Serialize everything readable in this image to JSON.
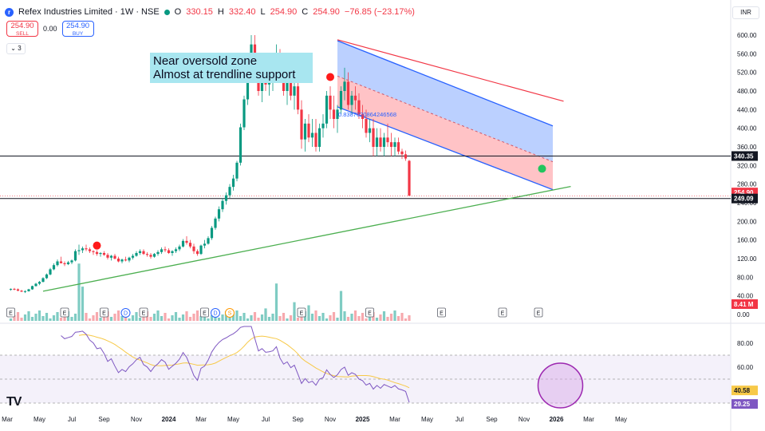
{
  "header": {
    "logo_letter": "r",
    "symbol_title": "Refex Industries Limited · 1W · NSE",
    "open_label": "O",
    "open_value": "330.15",
    "high_label": "H",
    "high_value": "332.40",
    "low_label": "L",
    "low_value": "254.90",
    "close_label": "C",
    "close_value": "254.90",
    "change": "−76.85 (−23.17%)"
  },
  "trade": {
    "sell_price": "254.90",
    "sell_label": "SELL",
    "spread": "0.00",
    "buy_price": "254.90",
    "buy_label": "BUY"
  },
  "indicators_collapse": "3",
  "currency_button": "INR",
  "annotation": {
    "line1": "Near oversold zone",
    "line2": "Almost at trendline support"
  },
  "fib_label": "0.8387020864246568",
  "colors": {
    "up": "#089981",
    "down": "#f23645",
    "channel_upper_fill": "#aac4ff",
    "channel_lower_fill": "#ffb4b8",
    "channel_line": "#2962ff",
    "trendline": "#4caf50",
    "red_line": "#f23645",
    "rsi_line": "#7e57c2",
    "rsi_ma": "#f7c948",
    "rsi_band": "#ede7f6",
    "volume_up": "#7fccc3",
    "volume_down": "#f7a9ae",
    "note_bg": "#a8e6f0"
  },
  "chart_data": [
    {
      "type": "candlestick",
      "title": "Refex Industries Limited · 1W · NSE",
      "price_axis_ticks": [
        "600.00",
        "560.00",
        "520.00",
        "480.00",
        "440.00",
        "400.00",
        "360.00",
        "320.00",
        "280.00",
        "240.00",
        "200.00",
        "160.00",
        "120.00",
        "80.00",
        "40.00",
        "0.00"
      ],
      "price_axis_values": [
        600,
        560,
        520,
        480,
        440,
        400,
        360,
        320,
        280,
        240,
        200,
        160,
        120,
        80,
        40,
        0
      ],
      "ylim": [
        0,
        620
      ],
      "price_labels": [
        {
          "text": "340.35",
          "value": 340.35,
          "style": "black"
        },
        {
          "text": "254.90",
          "value": 262,
          "style": "red"
        },
        {
          "text": "249.09",
          "value": 249.09,
          "style": "black"
        }
      ],
      "volume_label": "8.41 M",
      "horizontal_lines": [
        340.35,
        249.09
      ],
      "x_ticks": [
        "Mar",
        "May",
        "Jul",
        "Sep",
        "Nov",
        "2024",
        "Mar",
        "May",
        "Jul",
        "Sep",
        "Nov",
        "2025",
        "Mar",
        "May",
        "Jul",
        "Sep",
        "Nov",
        "2026",
        "Mar",
        "May"
      ],
      "x_tick_weeks": [
        0,
        9,
        18,
        27,
        36,
        45,
        54,
        63,
        72,
        81,
        90,
        99,
        108,
        117,
        126,
        135,
        144,
        153,
        162,
        171
      ],
      "trendline": {
        "start": {
          "week": 10,
          "price": 50
        },
        "end": {
          "week": 157,
          "price": 275
        }
      },
      "channel_upper": {
        "start": {
          "week": 92,
          "price": 588
        },
        "end": {
          "week": 152,
          "price": 405
        }
      },
      "channel_mid": {
        "start": {
          "week": 92,
          "price": 512
        },
        "end": {
          "week": 152,
          "price": 328
        }
      },
      "channel_lower": {
        "start": {
          "week": 92,
          "price": 446
        },
        "end": {
          "week": 152,
          "price": 268
        }
      },
      "red_line": {
        "start": {
          "week": 92,
          "price": 590
        },
        "end": {
          "week": 155,
          "price": 458
        }
      },
      "markers": [
        {
          "type": "red-dot",
          "week": 25,
          "price": 148
        },
        {
          "type": "red-dot",
          "week": 90,
          "price": 510
        },
        {
          "type": "green-dot",
          "week": 149,
          "price": 313
        }
      ],
      "earnings_markers": [
        {
          "letter": "E",
          "week": 1
        },
        {
          "letter": "E",
          "week": 16
        },
        {
          "letter": "E",
          "week": 27
        },
        {
          "letter": "D",
          "week": 33
        },
        {
          "letter": "E",
          "week": 38
        },
        {
          "letter": "E",
          "week": 55
        },
        {
          "letter": "D",
          "week": 58
        },
        {
          "letter": "S",
          "week": 62
        },
        {
          "letter": "E",
          "week": 82
        },
        {
          "letter": "E",
          "week": 101
        },
        {
          "letter": "E",
          "week": 121
        },
        {
          "letter": "E",
          "week": 138
        },
        {
          "letter": "E",
          "week": 148
        }
      ],
      "candles": [
        [
          54,
          56,
          51,
          55
        ],
        [
          55,
          57,
          52,
          54
        ],
        [
          54,
          56,
          50,
          51
        ],
        [
          51,
          53,
          48,
          49
        ],
        [
          49,
          52,
          46,
          50
        ],
        [
          50,
          55,
          49,
          54
        ],
        [
          54,
          62,
          53,
          61
        ],
        [
          61,
          68,
          60,
          66
        ],
        [
          66,
          72,
          63,
          70
        ],
        [
          70,
          80,
          69,
          78
        ],
        [
          78,
          88,
          76,
          86
        ],
        [
          86,
          100,
          84,
          97
        ],
        [
          97,
          110,
          95,
          106
        ],
        [
          106,
          118,
          103,
          114
        ],
        [
          114,
          124,
          110,
          110
        ],
        [
          110,
          114,
          104,
          108
        ],
        [
          108,
          115,
          106,
          112
        ],
        [
          112,
          118,
          108,
          116
        ],
        [
          116,
          140,
          114,
          136
        ],
        [
          136,
          150,
          128,
          138
        ],
        [
          138,
          146,
          132,
          142
        ],
        [
          142,
          150,
          136,
          140
        ],
        [
          140,
          144,
          132,
          136
        ],
        [
          136,
          138,
          128,
          134
        ],
        [
          134,
          138,
          126,
          130
        ],
        [
          130,
          134,
          124,
          132
        ],
        [
          132,
          136,
          126,
          128
        ],
        [
          128,
          132,
          118,
          122
        ],
        [
          122,
          128,
          116,
          126
        ],
        [
          126,
          130,
          118,
          120
        ],
        [
          120,
          124,
          112,
          114
        ],
        [
          114,
          120,
          110,
          118
        ],
        [
          118,
          124,
          114,
          116
        ],
        [
          116,
          124,
          112,
          122
        ],
        [
          122,
          130,
          118,
          126
        ],
        [
          126,
          136,
          124,
          132
        ],
        [
          132,
          140,
          128,
          136
        ],
        [
          136,
          140,
          128,
          130
        ],
        [
          130,
          134,
          124,
          128
        ],
        [
          128,
          132,
          120,
          124
        ],
        [
          124,
          132,
          122,
          130
        ],
        [
          130,
          138,
          126,
          134
        ],
        [
          134,
          144,
          130,
          140
        ],
        [
          140,
          146,
          134,
          138
        ],
        [
          138,
          142,
          130,
          132
        ],
        [
          132,
          138,
          126,
          136
        ],
        [
          136,
          144,
          132,
          140
        ],
        [
          140,
          150,
          136,
          146
        ],
        [
          146,
          162,
          144,
          158
        ],
        [
          158,
          168,
          150,
          154
        ],
        [
          154,
          160,
          142,
          146
        ],
        [
          146,
          152,
          130,
          136
        ],
        [
          136,
          140,
          126,
          130
        ],
        [
          130,
          150,
          128,
          148
        ],
        [
          148,
          160,
          142,
          152
        ],
        [
          152,
          168,
          150,
          164
        ],
        [
          164,
          190,
          160,
          186
        ],
        [
          186,
          210,
          182,
          206
        ],
        [
          206,
          232,
          200,
          226
        ],
        [
          226,
          250,
          220,
          244
        ],
        [
          244,
          262,
          236,
          256
        ],
        [
          256,
          280,
          250,
          274
        ],
        [
          274,
          300,
          266,
          292
        ],
        [
          292,
          330,
          286,
          326
        ],
        [
          326,
          410,
          320,
          402
        ],
        [
          402,
          470,
          396,
          462
        ],
        [
          462,
          540,
          450,
          530
        ],
        [
          530,
          600,
          500,
          580
        ],
        [
          580,
          600,
          520,
          530
        ],
        [
          530,
          560,
          470,
          480
        ],
        [
          480,
          520,
          456,
          510
        ],
        [
          510,
          540,
          480,
          494
        ],
        [
          494,
          520,
          470,
          500
        ],
        [
          500,
          530,
          480,
          510
        ],
        [
          510,
          580,
          500,
          560
        ],
        [
          560,
          570,
          500,
          510
        ],
        [
          510,
          530,
          470,
          480
        ],
        [
          480,
          510,
          450,
          500
        ],
        [
          500,
          520,
          460,
          470
        ],
        [
          470,
          500,
          440,
          490
        ],
        [
          490,
          500,
          430,
          440
        ],
        [
          440,
          460,
          356,
          376
        ],
        [
          376,
          420,
          350,
          410
        ],
        [
          410,
          430,
          370,
          380
        ],
        [
          380,
          420,
          360,
          390
        ],
        [
          390,
          420,
          350,
          360
        ],
        [
          360,
          410,
          350,
          400
        ],
        [
          400,
          430,
          380,
          410
        ],
        [
          410,
          480,
          400,
          470
        ],
        [
          470,
          490,
          420,
          440
        ],
        [
          440,
          470,
          400,
          420
        ],
        [
          420,
          450,
          390,
          440
        ],
        [
          440,
          490,
          430,
          480
        ],
        [
          480,
          530,
          460,
          500
        ],
        [
          500,
          520,
          440,
          450
        ],
        [
          450,
          480,
          430,
          470
        ],
        [
          470,
          490,
          440,
          460
        ],
        [
          460,
          475,
          420,
          430
        ],
        [
          430,
          450,
          400,
          420
        ],
        [
          420,
          440,
          380,
          390
        ],
        [
          390,
          420,
          370,
          400
        ],
        [
          400,
          420,
          340,
          360
        ],
        [
          360,
          400,
          340,
          380
        ],
        [
          380,
          400,
          350,
          360
        ],
        [
          360,
          390,
          340,
          380
        ],
        [
          380,
          410,
          360,
          370
        ],
        [
          370,
          390,
          340,
          360
        ],
        [
          360,
          380,
          340,
          370
        ],
        [
          370,
          380,
          344,
          350
        ],
        [
          350,
          356,
          334,
          344
        ],
        [
          344,
          352,
          330,
          335
        ],
        [
          330,
          332,
          255,
          255
        ]
      ],
      "volume_tall_weeks": [
        [
          20,
          "up",
          0.92
        ],
        [
          21,
          "up",
          0.55
        ],
        [
          75,
          "up",
          0.6
        ],
        [
          93,
          "up",
          0.48
        ],
        [
          149,
          "up",
          0.57
        ],
        [
          161,
          "up",
          0.96
        ],
        [
          163,
          "down",
          0.22
        ]
      ]
    },
    {
      "type": "line",
      "title": "RSI",
      "y_ticks": [
        "80.00",
        "60.00",
        "40.00"
      ],
      "y_tick_values": [
        80,
        60,
        40
      ],
      "ylim": [
        20,
        95
      ],
      "band_upper": 70,
      "band_lower": 30,
      "value_labels": [
        {
          "text": "40.58",
          "value": 40.58,
          "style": "yellow"
        },
        {
          "text": "29.25",
          "value": 29.25,
          "style": "purple"
        }
      ],
      "highlight_circle_week": 157
    }
  ]
}
